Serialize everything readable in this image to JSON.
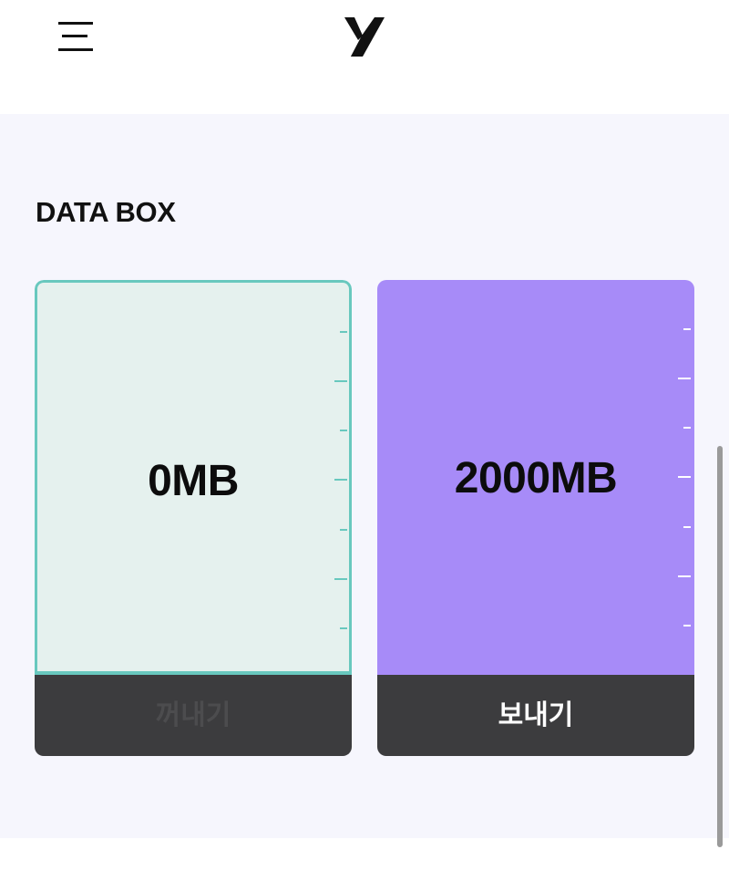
{
  "header": {
    "menu_icon": "hamburger-menu-icon",
    "logo_icon": "brand-logo-icon"
  },
  "data_box": {
    "title": "DATA BOX",
    "cards": [
      {
        "value": "0MB",
        "fill_fraction": 0,
        "action_label": "꺼내기",
        "action_enabled": false,
        "background": "#e5f1ee",
        "accent": "#68c8be",
        "tick_color": "#68c8be"
      },
      {
        "value": "2000MB",
        "fill_fraction": 1,
        "action_label": "보내기",
        "action_enabled": true,
        "background": "#a78bf8",
        "tick_color": "#ffffff"
      }
    ],
    "action_bar_color": "#3c3c3e"
  }
}
